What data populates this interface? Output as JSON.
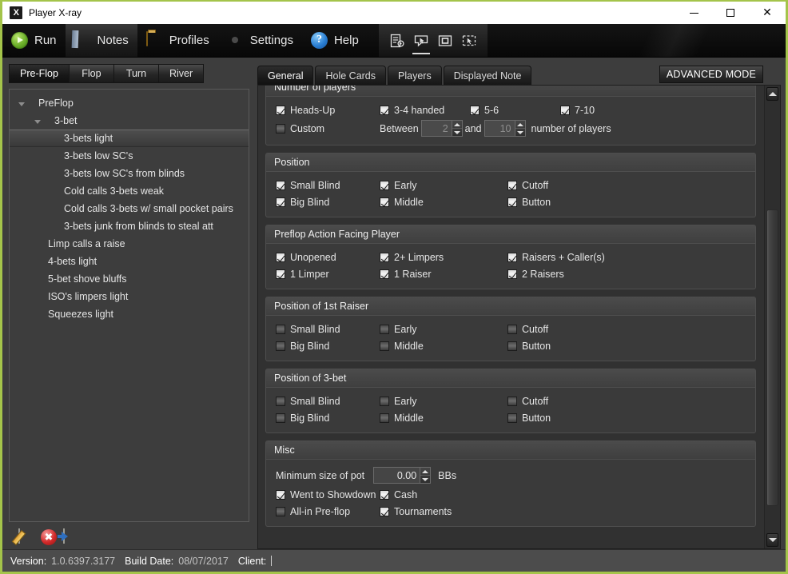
{
  "window": {
    "title": "Player X-ray",
    "app_icon": "x-ray-logo-icon",
    "minimize": "—",
    "maximize": "□",
    "close": "✕",
    "border_color": "#a4c44a"
  },
  "menubar": {
    "items": [
      {
        "label": "Run",
        "icon": "play-circle-icon",
        "active": false
      },
      {
        "label": "Notes",
        "icon": "notepad-icon",
        "active": true
      },
      {
        "label": "Profiles",
        "icon": "folder-icon",
        "active": false
      },
      {
        "label": "Settings",
        "icon": "gear-icon",
        "active": false
      },
      {
        "label": "Help",
        "icon": "question-circle-icon",
        "active": false
      }
    ],
    "tools": [
      {
        "icon": "document-settings-icon",
        "selected": false
      },
      {
        "icon": "cursor-window-icon",
        "selected": true
      },
      {
        "icon": "square-outline-icon",
        "selected": false
      },
      {
        "icon": "select-region-cursor-icon",
        "selected": false
      }
    ]
  },
  "left_panel": {
    "street_tabs": [
      {
        "label": "Pre-Flop",
        "active": true
      },
      {
        "label": "Flop",
        "active": false
      },
      {
        "label": "Turn",
        "active": false
      },
      {
        "label": "River",
        "active": false
      }
    ],
    "tree": [
      {
        "label": "PreFlop",
        "level": 0,
        "expander": true,
        "selected": false
      },
      {
        "label": "3-bet",
        "level": 1,
        "expander": true,
        "selected": false
      },
      {
        "label": "3-bets light",
        "level": 2,
        "expander": false,
        "selected": true
      },
      {
        "label": "3-bets low SC's",
        "level": 2,
        "expander": false,
        "selected": false
      },
      {
        "label": "3-bets low SC's from blinds",
        "level": 2,
        "expander": false,
        "selected": false
      },
      {
        "label": "Cold calls 3-bets weak",
        "level": 2,
        "expander": false,
        "selected": false
      },
      {
        "label": "Cold calls 3-bets w/ small pocket pairs",
        "level": 2,
        "expander": false,
        "selected": false
      },
      {
        "label": "3-bets junk from blinds to steal att",
        "level": 2,
        "expander": false,
        "selected": false
      },
      {
        "label": "Limp calls a raise",
        "level": 1,
        "expander": false,
        "selected": false
      },
      {
        "label": "4-bets light",
        "level": 1,
        "expander": false,
        "selected": false
      },
      {
        "label": "5-bet shove bluffs",
        "level": 1,
        "expander": false,
        "selected": false
      },
      {
        "label": "ISO's limpers light",
        "level": 1,
        "expander": false,
        "selected": false
      },
      {
        "label": "Squeezes light",
        "level": 1,
        "expander": false,
        "selected": false
      }
    ],
    "actions": [
      {
        "icon": "edit-note-icon",
        "name": "edit-note-button"
      },
      {
        "icon": "delete-note-icon",
        "name": "delete-note-button"
      },
      {
        "icon": "add-note-icon",
        "name": "add-note-button"
      }
    ]
  },
  "right_panel": {
    "tabs": [
      {
        "label": "General",
        "active": true
      },
      {
        "label": "Hole Cards",
        "active": false
      },
      {
        "label": "Players",
        "active": false
      },
      {
        "label": "Displayed Note",
        "active": false
      }
    ],
    "advanced_mode": "ADVANCED MODE",
    "groups": {
      "number_of_players": {
        "title": "Number of players",
        "row1": [
          {
            "label": "Heads-Up",
            "checked": true
          },
          {
            "label": "3-4 handed",
            "checked": true
          },
          {
            "label": "5-6",
            "checked": true
          },
          {
            "label": "7-10",
            "checked": true
          }
        ],
        "custom": {
          "label": "Custom",
          "checked": false
        },
        "between_label": "Between",
        "min_value": "2",
        "and_label": "and",
        "max_value": "10",
        "suffix_label": "number of players"
      },
      "position": {
        "title": "Position",
        "items": [
          {
            "label": "Small Blind",
            "checked": true
          },
          {
            "label": "Early",
            "checked": true
          },
          {
            "label": "Cutoff",
            "checked": true
          },
          {
            "label": "Big Blind",
            "checked": true
          },
          {
            "label": "Middle",
            "checked": true
          },
          {
            "label": "Button",
            "checked": true
          }
        ]
      },
      "preflop_action": {
        "title": "Preflop Action Facing Player",
        "items": [
          {
            "label": "Unopened",
            "checked": true
          },
          {
            "label": "2+ Limpers",
            "checked": true
          },
          {
            "label": "Raisers + Caller(s)",
            "checked": true
          },
          {
            "label": "1 Limper",
            "checked": true
          },
          {
            "label": "1 Raiser",
            "checked": true
          },
          {
            "label": "2 Raisers",
            "checked": true
          }
        ]
      },
      "position_1st_raiser": {
        "title": "Position of 1st Raiser",
        "items": [
          {
            "label": "Small Blind",
            "checked": false
          },
          {
            "label": "Early",
            "checked": false
          },
          {
            "label": "Cutoff",
            "checked": false
          },
          {
            "label": "Big Blind",
            "checked": false
          },
          {
            "label": "Middle",
            "checked": false
          },
          {
            "label": "Button",
            "checked": false
          }
        ]
      },
      "position_3bet": {
        "title": "Position of 3-bet",
        "items": [
          {
            "label": "Small Blind",
            "checked": false
          },
          {
            "label": "Early",
            "checked": false
          },
          {
            "label": "Cutoff",
            "checked": false
          },
          {
            "label": "Big Blind",
            "checked": false
          },
          {
            "label": "Middle",
            "checked": false
          },
          {
            "label": "Button",
            "checked": false
          }
        ]
      },
      "misc": {
        "title": "Misc",
        "min_pot_label": "Minimum size of pot",
        "min_pot_value": "0.00",
        "min_pot_unit": "BBs",
        "items": [
          {
            "label": "Went to Showdown",
            "checked": true
          },
          {
            "label": "Cash",
            "checked": true
          },
          {
            "label": "All-in Pre-flop",
            "checked": false
          },
          {
            "label": "Tournaments",
            "checked": true
          }
        ]
      }
    },
    "scrollbar": {
      "up_icon": "scroll-up-icon",
      "down_icon": "scroll-down-icon"
    }
  },
  "statusbar": {
    "version_label": "Version:",
    "version_value": "1.0.6397.3177",
    "build_label": "Build Date:",
    "build_value": "08/07/2017",
    "client_label": "Client:",
    "client_value": ""
  }
}
